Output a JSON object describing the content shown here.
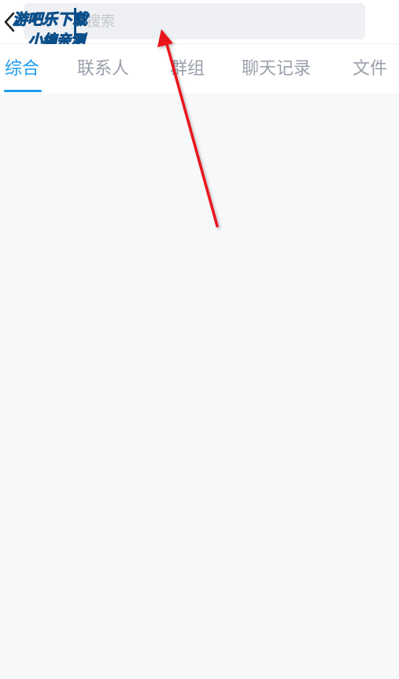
{
  "header": {
    "search_placeholder": "搜索",
    "watermark_line1": "游吧乐下载",
    "watermark_line2": "小编亲测"
  },
  "tabs": [
    {
      "label": "综合",
      "active": true
    },
    {
      "label": "联系人",
      "active": false
    },
    {
      "label": "群组",
      "active": false
    },
    {
      "label": "聊天记录",
      "active": false
    },
    {
      "label": "文件",
      "active": false
    }
  ],
  "colors": {
    "accent": "#1e9bf0",
    "inactive_tab": "#9aa0ab",
    "content_bg": "#f7f8fa",
    "annotation_arrow": "#e8141b"
  },
  "icons": {
    "back": "chevron-left-icon",
    "annotation": "arrow-annotation"
  }
}
